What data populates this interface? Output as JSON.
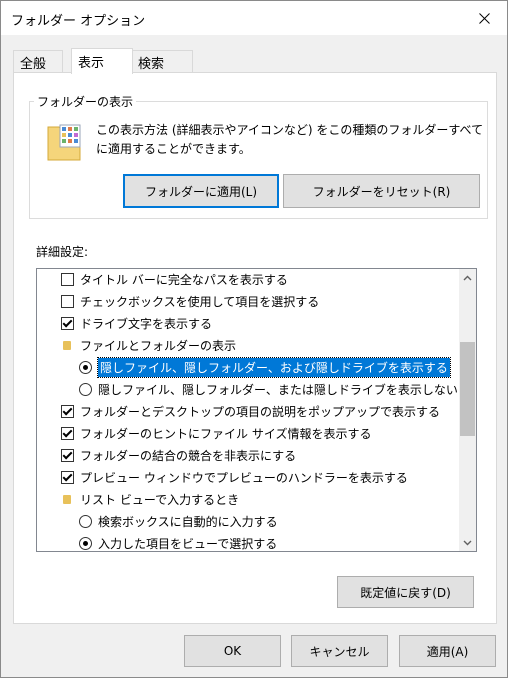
{
  "window": {
    "title": "フォルダー オプション"
  },
  "tabs": [
    {
      "label": "全般",
      "active": false
    },
    {
      "label": "表示",
      "active": true
    },
    {
      "label": "検索",
      "active": false
    }
  ],
  "folder_view": {
    "group_title": "フォルダーの表示",
    "description_line1": "この表示方法 (詳細表示やアイコンなど) をこの種類のフォルダーすべて",
    "description_line2": "に適用することができます。",
    "apply_button": "フォルダーに適用(L)",
    "reset_button": "フォルダーをリセット(R)"
  },
  "advanced": {
    "label": "詳細設定:",
    "items": [
      {
        "type": "checkbox",
        "checked": false,
        "indent": 1,
        "label": "タイトル バーに完全なパスを表示する"
      },
      {
        "type": "checkbox",
        "checked": false,
        "indent": 1,
        "label": "チェックボックスを使用して項目を選択する"
      },
      {
        "type": "checkbox",
        "checked": true,
        "indent": 1,
        "label": "ドライブ文字を表示する"
      },
      {
        "type": "folder",
        "indent": 1,
        "label": "ファイルとフォルダーの表示"
      },
      {
        "type": "radio",
        "checked": true,
        "indent": 2,
        "selected": true,
        "label": "隠しファイル、隠しフォルダー、および隠しドライブを表示する"
      },
      {
        "type": "radio",
        "checked": false,
        "indent": 2,
        "label": "隠しファイル、隠しフォルダー、または隠しドライブを表示しない"
      },
      {
        "type": "checkbox",
        "checked": true,
        "indent": 1,
        "label": "フォルダーとデスクトップの項目の説明をポップアップで表示する"
      },
      {
        "type": "checkbox",
        "checked": true,
        "indent": 1,
        "label": "フォルダーのヒントにファイル サイズ情報を表示する"
      },
      {
        "type": "checkbox",
        "checked": true,
        "indent": 1,
        "label": "フォルダーの結合の競合を非表示にする"
      },
      {
        "type": "checkbox",
        "checked": true,
        "indent": 1,
        "label": "プレビュー ウィンドウでプレビューのハンドラーを表示する"
      },
      {
        "type": "folder",
        "indent": 1,
        "label": "リスト ビューで入力するとき"
      },
      {
        "type": "radio",
        "checked": false,
        "indent": 2,
        "label": "検索ボックスに自動的に入力する"
      },
      {
        "type": "radio",
        "checked": true,
        "indent": 2,
        "label": "入力した項目をビューで選択する"
      }
    ],
    "restore_defaults_button": "既定値に戻す(D)"
  },
  "footer": {
    "ok_button": "OK",
    "cancel_button": "キャンセル",
    "apply_button": "適用(A)"
  }
}
